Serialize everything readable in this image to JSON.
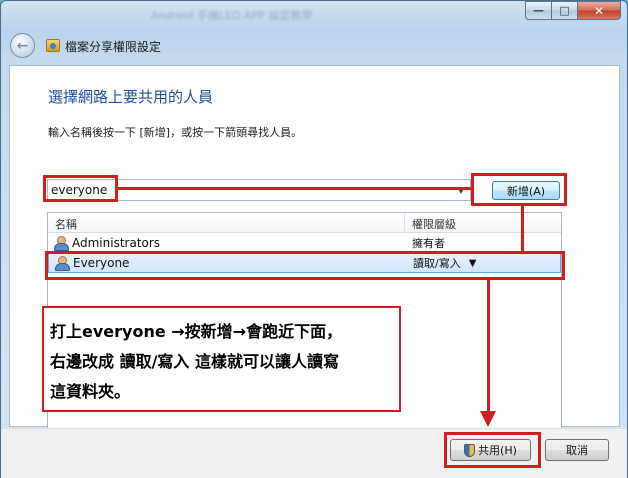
{
  "window": {
    "title_blurred": "Android 手機LED APP 設定教學",
    "minimize_label": "—",
    "maximize_label": "□",
    "close_label": "✕"
  },
  "nav": {
    "back_icon": "←",
    "title": "檔案分享權限設定"
  },
  "content": {
    "heading": "選擇網路上要共用的人員",
    "instruction": "輸入名稱後按一下 [新增]，或按一下箭頭尋找人員。",
    "input_value": "everyone",
    "dropdown_glyph": "▼",
    "add_button": "新增(A)"
  },
  "list": {
    "columns": [
      "名稱",
      "權限層級"
    ],
    "rows": [
      {
        "name": "Administrators",
        "permission": "擁有者",
        "selected": false
      },
      {
        "name": "Everyone",
        "permission": "讀取/寫入",
        "selected": true,
        "dropdown": "▼"
      }
    ]
  },
  "annotation": {
    "lines": [
      "打上everyone →按新增→會跑近下面，",
      "右邊改成 讀取/寫入 這樣就可以讓人讀寫",
      "這資料夾。"
    ],
    "color": "#d01d1d"
  },
  "footer": {
    "share_button": "共用(H)",
    "cancel_button": "取消"
  }
}
